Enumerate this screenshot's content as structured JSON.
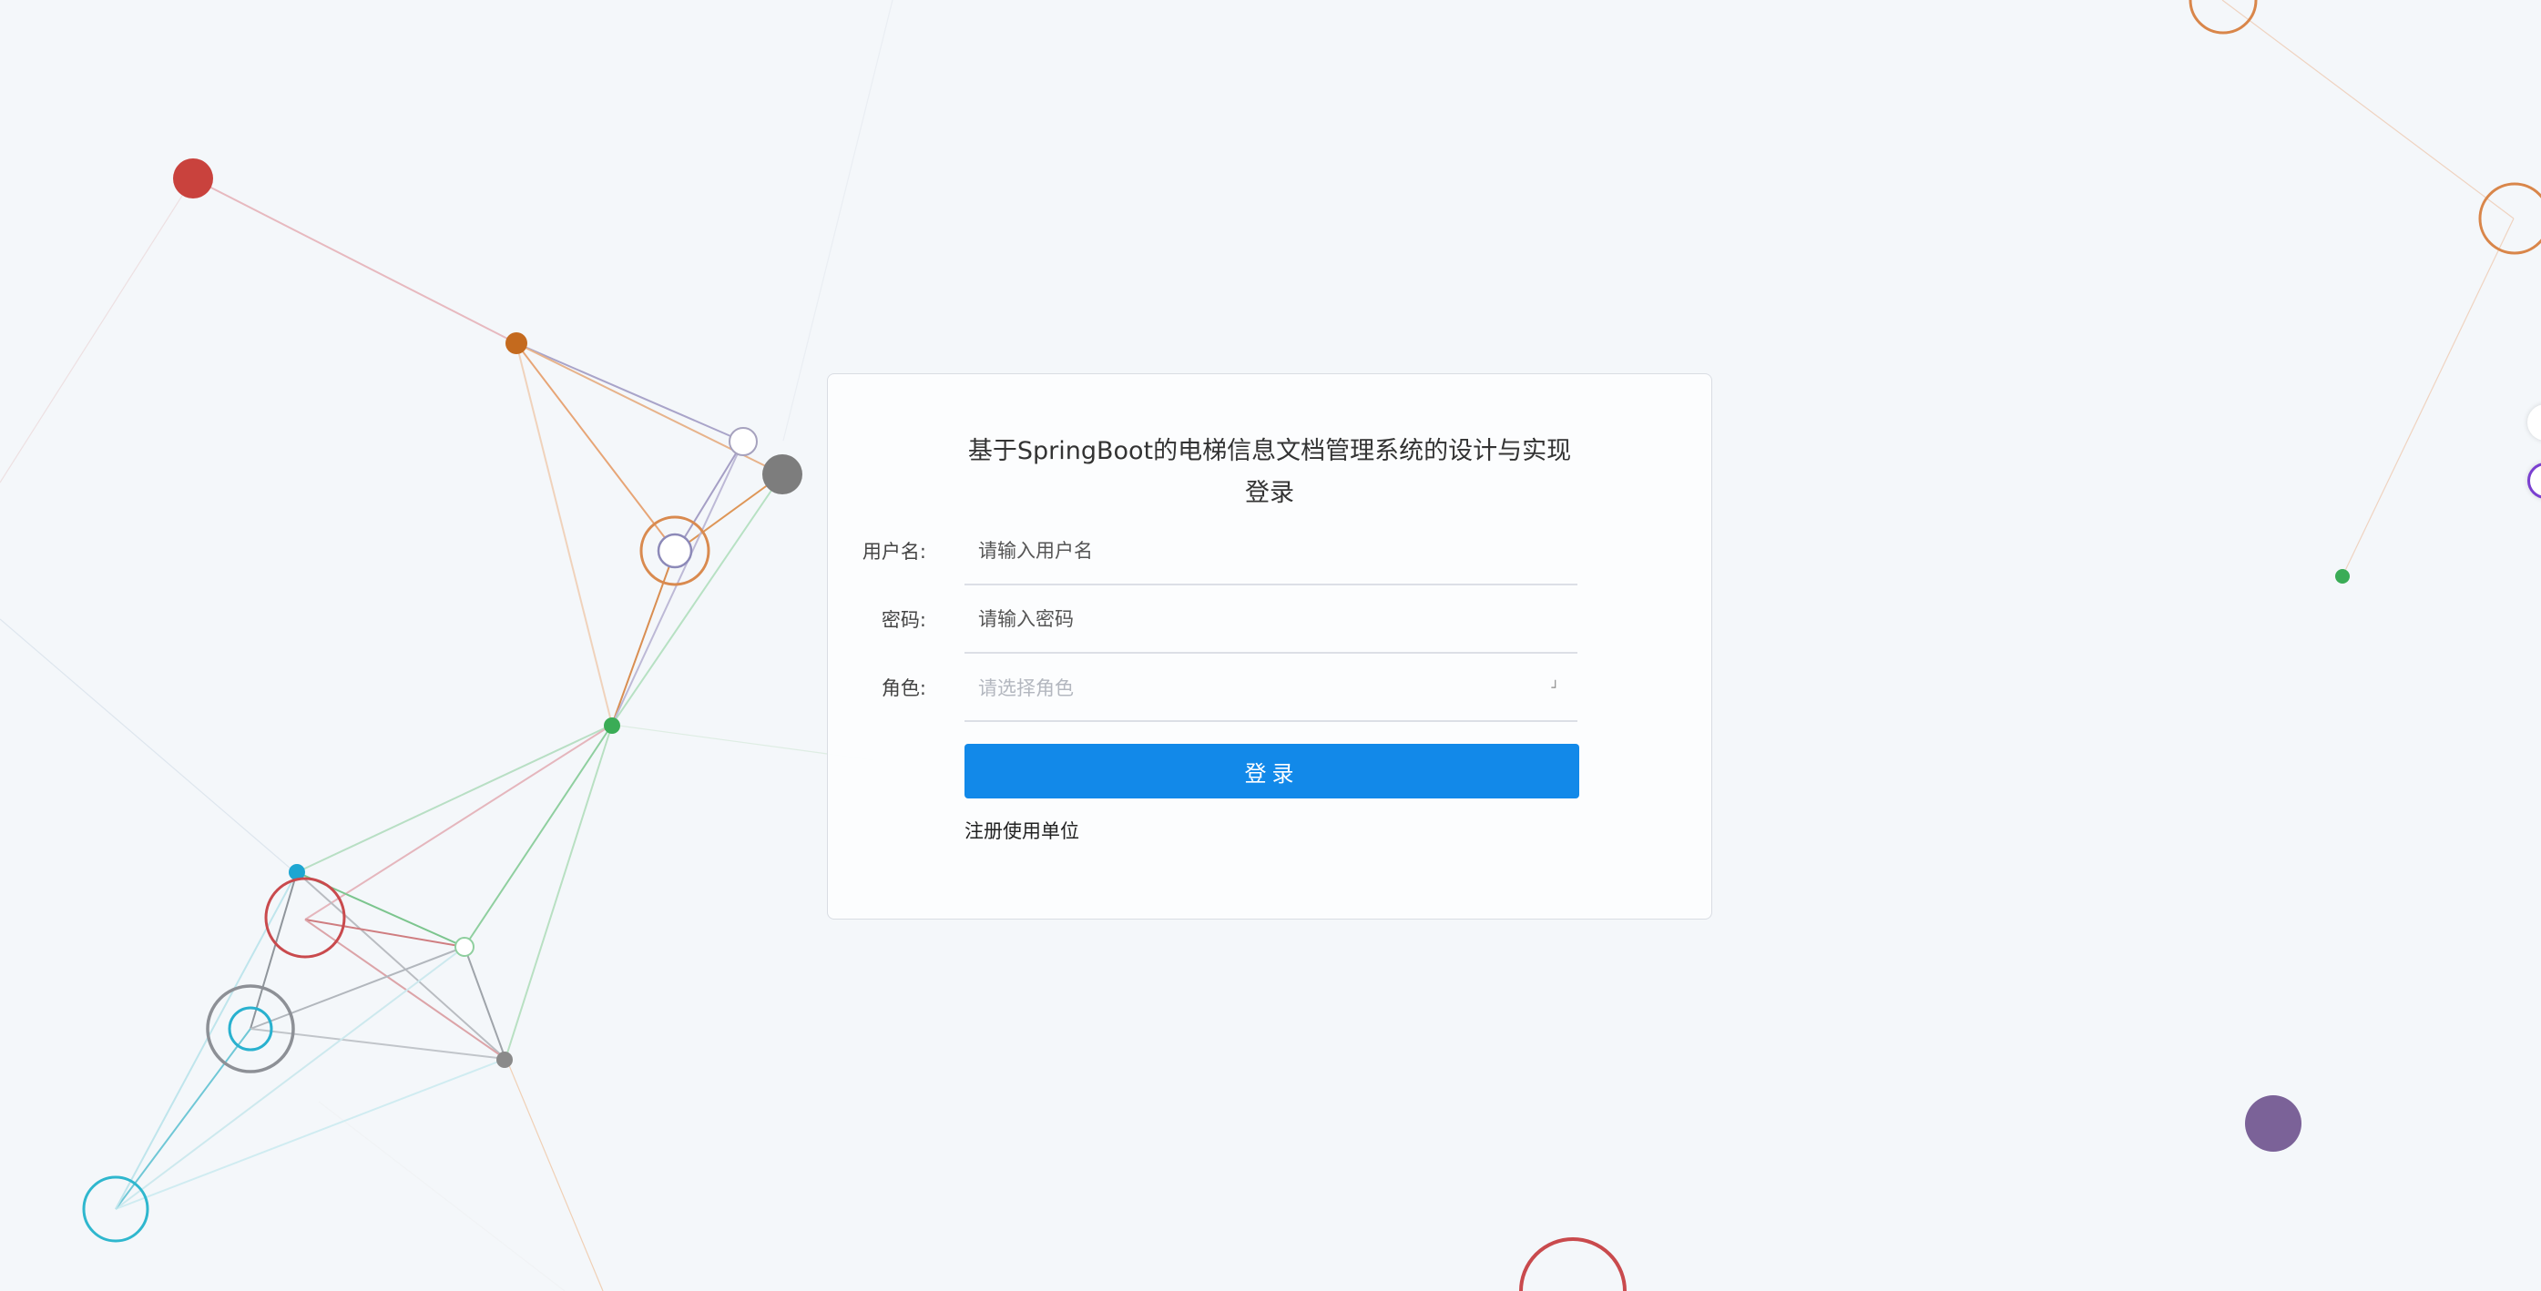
{
  "login": {
    "title_line1": "基于SpringBoot的电梯信息文档管理系统的设计与实现",
    "title_line2": "登录",
    "username_label": "用户名:",
    "username_placeholder": "请输入用户名",
    "password_label": "密码:",
    "password_placeholder": "请输入密码",
    "role_label": "角色:",
    "role_placeholder": "请选择角色",
    "submit_label": "登录",
    "register_link": "注册使用单位"
  },
  "colors": {
    "primary": "#1289e9",
    "background": "#f4f7fa"
  }
}
